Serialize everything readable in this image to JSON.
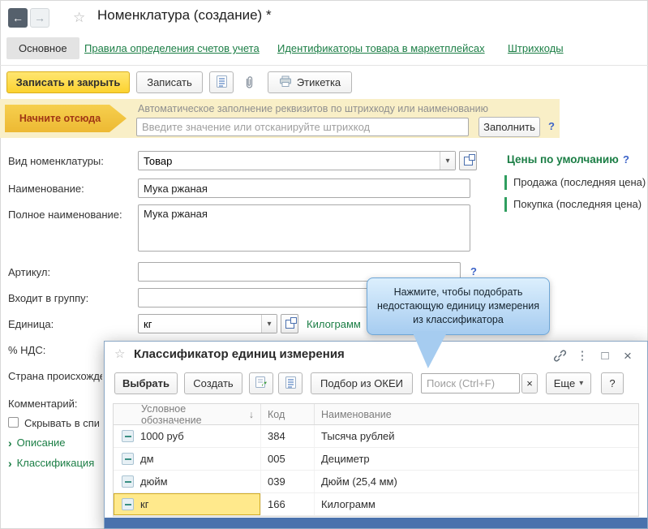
{
  "icons": {
    "back_arrow": "←",
    "forward_arrow": "→",
    "star": "☆",
    "dropdown_arrow": "▾",
    "help": "?",
    "kebab": "⋮",
    "maximize": "□",
    "close": "×",
    "clear": "×",
    "sort_desc": "↓",
    "expander_chevron": "›"
  },
  "header": {
    "title": "Номенклатура (создание) *"
  },
  "nav": {
    "active_tab": "Основное",
    "links": [
      "Правила определения счетов учета",
      "Идентификаторы товара в маркетплейсах",
      "Штрихкоды"
    ]
  },
  "toolbar": {
    "save_and_close": "Записать и закрыть",
    "save": "Записать",
    "label_button": "Этикетка"
  },
  "banner": {
    "arrow_label": "Начните отсюда",
    "caption": "Автоматическое заполнение реквизитов по штрихкоду или наименованию",
    "input_placeholder": "Введите значение или отсканируйте штрихкод",
    "fill_button": "Заполнить"
  },
  "form": {
    "kind_label": "Вид номенклатуры:",
    "kind_value": "Товар",
    "name_label": "Наименование:",
    "name_value": "Мука ржаная",
    "full_name_label": "Полное наименование:",
    "full_name_value": "Мука ржаная",
    "article_label": "Артикул:",
    "article_value": "",
    "group_label": "Входит в группу:",
    "group_value": "",
    "unit_label": "Единица:",
    "unit_value": "кг",
    "unit_link": "Килограмм",
    "vat_label": "% НДС:",
    "country_label": "Страна происхождения:",
    "comment_label": "Комментарий:",
    "hide_checkbox_label": "Скрывать в списках",
    "hide_checkbox_checked": false,
    "expander_description": "Описание",
    "expander_classification": "Классификация"
  },
  "prices": {
    "title": "Цены по умолчанию",
    "items": [
      "Продажа (последняя цена)",
      "Покупка (последняя цена)"
    ]
  },
  "tooltip": {
    "text": "Нажмите, чтобы подобрать недостающую единицу измерения из классификатора"
  },
  "classifier": {
    "title": "Классификатор единиц измерения",
    "toolbar": {
      "select": "Выбрать",
      "create": "Создать",
      "okei_pick": "Подбор из ОКЕИ",
      "search_placeholder": "Поиск (Ctrl+F)",
      "more": "Еще"
    },
    "table": {
      "columns": [
        "Условное обозначение",
        "Код",
        "Наименование"
      ],
      "selected_row_index": 3,
      "rows": [
        {
          "symbol": "1000 руб",
          "code": "384",
          "name": "Тысяча рублей"
        },
        {
          "symbol": "дм",
          "code": "005",
          "name": "Дециметр"
        },
        {
          "symbol": "дюйм",
          "code": "039",
          "name": "Дюйм (25,4 мм)"
        },
        {
          "symbol": "кг",
          "code": "166",
          "name": "Килограмм"
        }
      ]
    }
  },
  "colors": {
    "primary_yellow": "#fcd22f",
    "link_green": "#1b7e45",
    "help_blue": "#3c63c8",
    "selection_yellow": "#ffe98c",
    "tooltip_blue": "#a6ccf0",
    "bottom_bar_blue": "#4a72ad",
    "start_arrow_text": "#a03614"
  }
}
